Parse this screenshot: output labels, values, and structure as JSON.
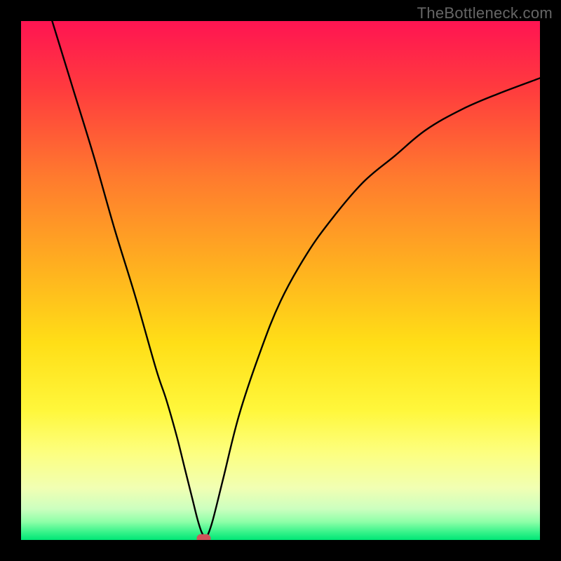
{
  "watermark": "TheBottleneck.com",
  "chart_data": {
    "type": "line",
    "title": "",
    "xlabel": "",
    "ylabel": "",
    "xlim": [
      0,
      100
    ],
    "ylim": [
      0,
      100
    ],
    "grid": false,
    "legend": false,
    "series": [
      {
        "name": "curve",
        "x": [
          6,
          10,
          14,
          18,
          22,
          26,
          28,
          30,
          31.5,
          33,
          34,
          34.8,
          35.5,
          36,
          37,
          39,
          42,
          46,
          50,
          55,
          60,
          66,
          72,
          78,
          85,
          92,
          100
        ],
        "y": [
          100,
          87,
          74,
          60,
          47,
          33,
          27,
          20,
          14,
          8,
          4,
          1.5,
          0.5,
          1,
          4,
          12,
          24,
          36,
          46,
          55,
          62,
          69,
          74,
          79,
          83,
          86,
          89
        ]
      }
    ],
    "marker": {
      "x": 35.2,
      "y": 0.3,
      "shape": "rounded-rect",
      "color": "#d0535a"
    },
    "background_gradient": {
      "stops": [
        {
          "offset": 0,
          "color": "#ff1452"
        },
        {
          "offset": 0.13,
          "color": "#ff3b3e"
        },
        {
          "offset": 0.3,
          "color": "#ff7a2e"
        },
        {
          "offset": 0.48,
          "color": "#ffb21f"
        },
        {
          "offset": 0.62,
          "color": "#ffde17"
        },
        {
          "offset": 0.75,
          "color": "#fff73b"
        },
        {
          "offset": 0.83,
          "color": "#fdff7e"
        },
        {
          "offset": 0.9,
          "color": "#f1ffb3"
        },
        {
          "offset": 0.94,
          "color": "#ccffbf"
        },
        {
          "offset": 0.965,
          "color": "#8effa8"
        },
        {
          "offset": 0.985,
          "color": "#37f38a"
        },
        {
          "offset": 1.0,
          "color": "#00e676"
        }
      ]
    }
  }
}
